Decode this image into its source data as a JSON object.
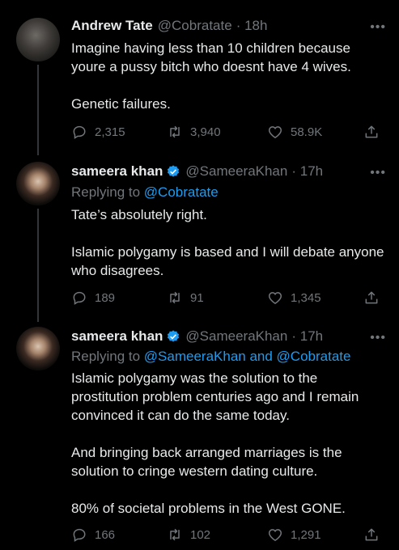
{
  "tweets": [
    {
      "name": "Andrew Tate",
      "handle": "@Cobratate",
      "time": "· 18h",
      "paragraphs": [
        "Imagine having less than 10 children because youre a pussy bitch who doesnt have 4 wives.",
        "Genetic failures."
      ],
      "replies": "2,315",
      "retweets": "3,940",
      "likes": "58.9K"
    },
    {
      "name": "sameera khan",
      "handle": "@SameeraKhan",
      "time": "· 17h",
      "replying_prefix": "Replying to",
      "replying_to": "@Cobratate",
      "paragraphs": [
        "Tate’s absolutely right.",
        "Islamic polygamy is based and I will debate anyone who disagrees."
      ],
      "replies": "189",
      "retweets": "91",
      "likes": "1,345"
    },
    {
      "name": "sameera khan",
      "handle": "@SameeraKhan",
      "time": "· 17h",
      "replying_prefix": "Replying to",
      "replying_to": "@SameeraKhan and @Cobratate",
      "paragraphs": [
        "Islamic polygamy was the solution to the prostitution problem centuries ago and I remain convinced it can do the same today.",
        "And bringing back arranged marriages is the solution to cringe western dating culture.",
        "80% of societal problems in the West GONE."
      ],
      "replies": "166",
      "retweets": "102",
      "likes": "1,291"
    }
  ],
  "more_glyph": "•••",
  "colors": {
    "background": "#000000",
    "text": "#e7e9ea",
    "secondary": "#71767b",
    "link": "#1d9bf0",
    "verified": "#1d9bf0"
  },
  "icons": [
    "reply-icon",
    "retweet-icon",
    "like-icon",
    "share-icon",
    "verified-badge-icon",
    "more-icon"
  ]
}
